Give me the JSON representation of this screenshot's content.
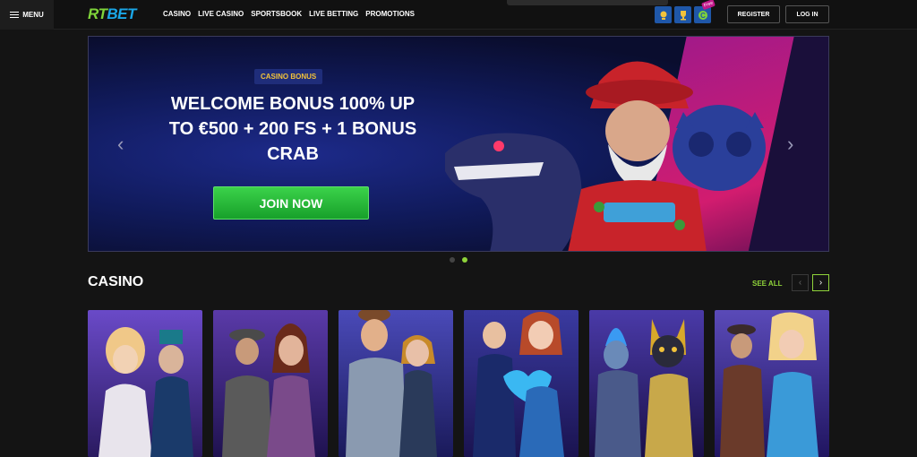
{
  "header": {
    "menu_label": "MENU",
    "logo": {
      "part1": "RT",
      "part2": "BET"
    },
    "nav": [
      "CASINO",
      "LIVE CASINO",
      "SPORTSBOOK",
      "LIVE BETTING",
      "PROMOTIONS"
    ],
    "icons": [
      {
        "name": "trophy-icon"
      },
      {
        "name": "cup-icon"
      },
      {
        "name": "coin-icon",
        "tag": "Free"
      }
    ],
    "register_label": "REGISTER",
    "login_label": "LOG IN"
  },
  "banner": {
    "badge": "CASINO BONUS",
    "headline": "WELCOME BONUS 100% UP TO €500 + 200 FS + 1 BONUS CRAB",
    "cta": "JOIN NOW",
    "prev_arrow": "‹",
    "next_arrow": "›",
    "slides": 2,
    "active_slide": 2
  },
  "casino": {
    "title": "CASINO",
    "see_all": "SEE ALL",
    "prev": "‹",
    "next": "›",
    "tiles": [
      {
        "theme": "goddess-and-wizard",
        "color1": "#5a3aa8",
        "color2": "#2a1a60"
      },
      {
        "theme": "explorers",
        "color1": "#4a2a8a",
        "color2": "#1f1250"
      },
      {
        "theme": "detective-and-lady",
        "color1": "#3a3a9a",
        "color2": "#1a1a5a"
      },
      {
        "theme": "royal-romance",
        "color1": "#2a2a7a",
        "color2": "#1a1350"
      },
      {
        "theme": "egyptian-cat",
        "color1": "#3a2a8a",
        "color2": "#1a1048"
      },
      {
        "theme": "adventurers",
        "color1": "#4a3a9a",
        "color2": "#201560"
      }
    ]
  },
  "colors": {
    "accent": "#8fd33a",
    "cta": "#17a02a",
    "brand_blue": "#1aa7e8"
  }
}
